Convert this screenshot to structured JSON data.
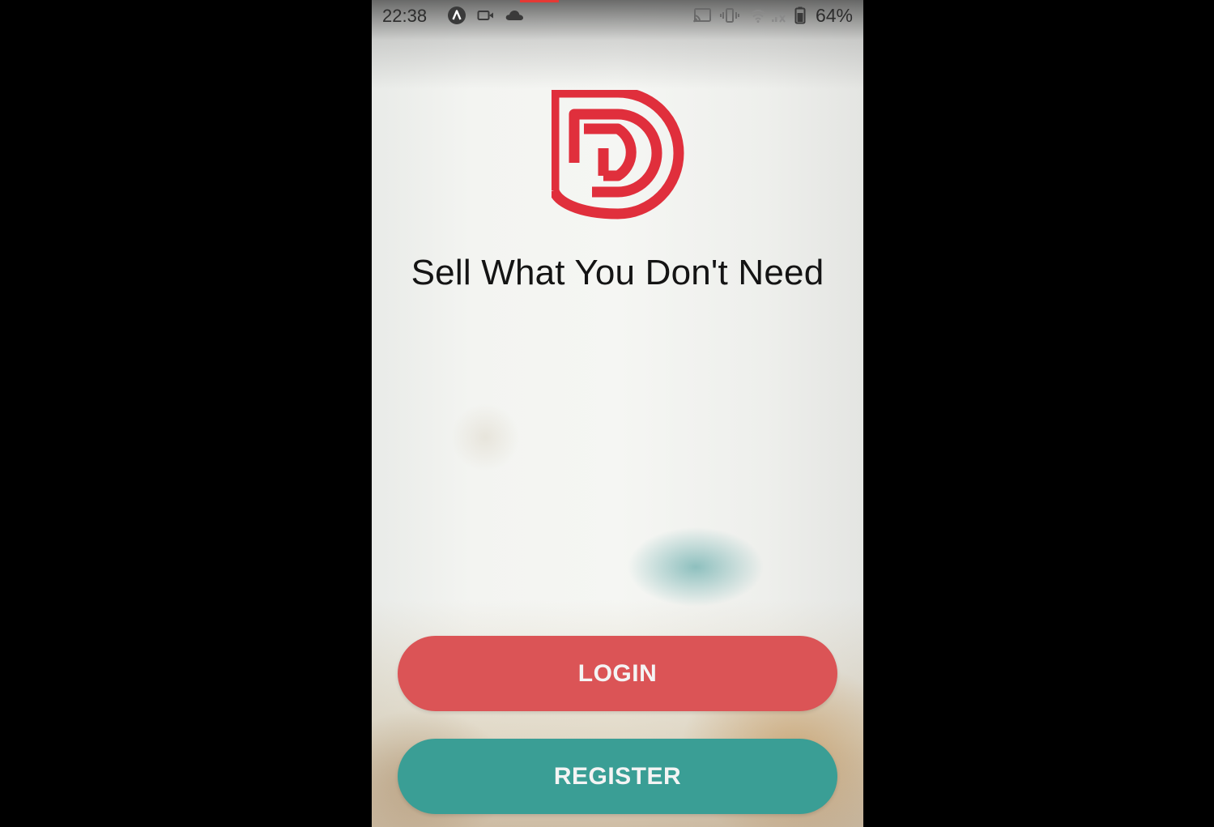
{
  "status_bar": {
    "time": "22:38",
    "battery": "64%",
    "left_icons": [
      "app-notification-icon",
      "video-camera-icon",
      "cloud-icon"
    ],
    "right_icons": [
      "cast-icon",
      "vibrate-icon",
      "wifi-icon",
      "signal-icon",
      "battery-icon"
    ]
  },
  "logo": {
    "name": "brand-logo",
    "color": "#e02f3c"
  },
  "tagline": "Sell What You Don't Need",
  "buttons": {
    "login_label": "LOGIN",
    "register_label": "REGISTER",
    "login_color": "#db5456",
    "register_color": "#3a9e95"
  }
}
